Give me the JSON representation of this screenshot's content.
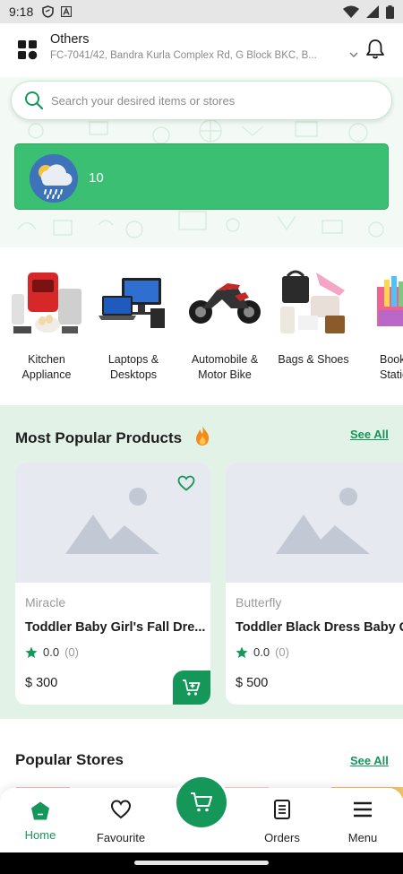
{
  "status_bar": {
    "time": "9:18"
  },
  "header": {
    "title": "Others",
    "address": "FC-7041/42, Bandra Kurla Complex Rd, G Block BKC, B..."
  },
  "search": {
    "placeholder": "Search your desired items or stores"
  },
  "weather": {
    "value": "10"
  },
  "categories": [
    {
      "label": "Kitchen\nAppliance",
      "icon": "kitchen-appliance-image"
    },
    {
      "label": "Laptops &\nDesktops",
      "icon": "laptop-image"
    },
    {
      "label": "Automobile &\nMotor Bike",
      "icon": "motorbike-image"
    },
    {
      "label": "Bags & Shoes",
      "icon": "bags-shoes-image"
    },
    {
      "label": "Book\nStatio",
      "icon": "stationery-image"
    }
  ],
  "popular_products": {
    "title": "Most Popular Products",
    "see_all": "See All",
    "items": [
      {
        "store": "Miracle",
        "name": "Toddler Baby Girl's Fall Dre...",
        "rating": "0.0",
        "rating_count": "(0)",
        "price": "$ 300"
      },
      {
        "store": "Butterfly",
        "name": "Toddler Black Dress Baby G",
        "rating": "0.0",
        "rating_count": "(0)",
        "price": "$ 500"
      }
    ]
  },
  "popular_stores": {
    "title": "Popular Stores",
    "see_all": "See All"
  },
  "bottom_nav": {
    "home": "Home",
    "favourite": "Favourite",
    "orders": "Orders",
    "menu": "Menu"
  },
  "colors": {
    "accent": "#16975a",
    "banner": "#3bbf73",
    "section_bg": "#e3f2e7"
  }
}
